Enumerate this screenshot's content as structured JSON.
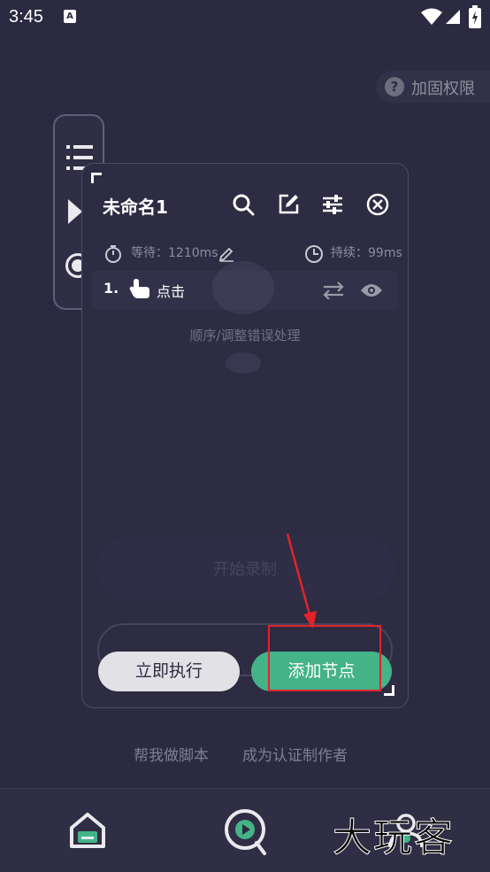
{
  "status_bar": {
    "time": "3:45",
    "notification_badge": "A"
  },
  "permission_chip": {
    "icon": "help-circle-icon",
    "label": "加固权限"
  },
  "mini_toolbar": {
    "icons": [
      "list-icon",
      "play-icon",
      "record-icon"
    ]
  },
  "panel": {
    "title": "未命名1",
    "toolbar_icons": [
      "search-icon",
      "edit-icon",
      "settings-sliders-icon",
      "close-icon"
    ],
    "wait_label": "等待：1210ms",
    "duration_label": "持续：99ms",
    "steps": [
      {
        "number": "1.",
        "label": "点击",
        "icon": "tap-hand-icon"
      }
    ],
    "empty_hint": "顺序/调整错误处理",
    "ghost_button_label": "开始录制",
    "run_button": "立即执行",
    "add_button": "添加节点"
  },
  "links": {
    "help_script": "帮我做脚本",
    "become_author": "成为认证制作者"
  },
  "bottom_nav": {
    "items": [
      "home-icon",
      "run-icon",
      "user-icon"
    ]
  },
  "watermark": "大玩客",
  "colors": {
    "background": "#2b2a40",
    "accent_green": "#44b387",
    "annotation_red": "#e3232a"
  }
}
